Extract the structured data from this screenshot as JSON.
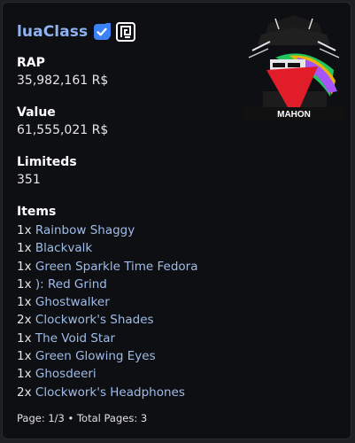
{
  "user": {
    "name": "luaClass"
  },
  "avatar": {
    "badge_text": "MAHON"
  },
  "stats": {
    "rap_label": "RAP",
    "rap_value": "35,982,161 R$",
    "value_label": "Value",
    "value_value": "61,555,021 R$",
    "limiteds_label": "Limiteds",
    "limiteds_value": "351"
  },
  "items": {
    "label": "Items",
    "list": [
      {
        "qty": "1x",
        "name": "Rainbow Shaggy"
      },
      {
        "qty": "1x",
        "name": "Blackvalk"
      },
      {
        "qty": "1x",
        "name": "Green Sparkle Time Fedora"
      },
      {
        "qty": "1x",
        "name": "): Red Grind"
      },
      {
        "qty": "1x",
        "name": "Ghostwalker"
      },
      {
        "qty": "2x",
        "name": "Clockwork's Shades"
      },
      {
        "qty": "1x",
        "name": "The Void Star"
      },
      {
        "qty": "1x",
        "name": "Green Glowing Eyes"
      },
      {
        "qty": "1x",
        "name": "Ghosdeeri"
      },
      {
        "qty": "2x",
        "name": "Clockwork's Headphones"
      }
    ]
  },
  "footer": {
    "pagination": "Page: 1/3 • Total Pages: 3"
  },
  "icons": {
    "verified": "verified-badge-icon",
    "brand": "rolimons-logo-icon"
  },
  "colors": {
    "background": "#0e0f12",
    "username": "#8fb3f0",
    "item_link": "#9fbce8",
    "verified_blue": "#3b82f6"
  }
}
